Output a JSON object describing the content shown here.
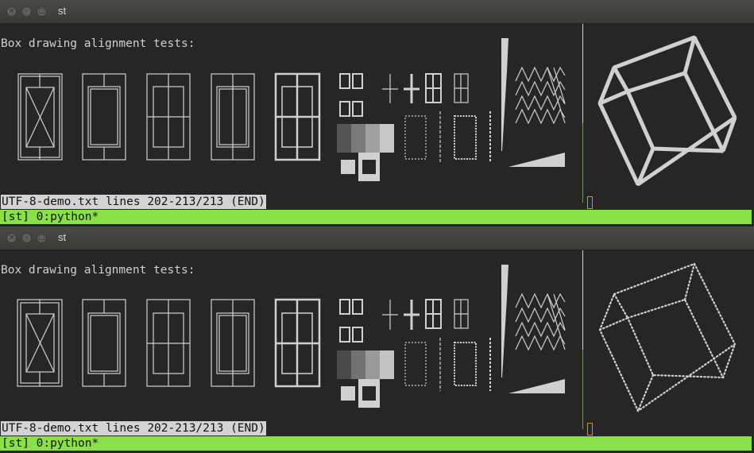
{
  "windows": [
    {
      "title": "st",
      "heading": "Box drawing alignment tests:",
      "status_line": "UTF-8-demo.txt lines 202-213/213 (END)",
      "tmux_status": "[st] 0:python*",
      "cube_style": "solid"
    },
    {
      "title": "st",
      "heading": "Box drawing alignment tests:",
      "status_line": "UTF-8-demo.txt lines 202-213/213 (END)",
      "tmux_status": "[st] 0:python*",
      "cube_style": "dotted"
    }
  ],
  "colors": {
    "tmux_bar": "#8ae049",
    "status_bg": "#d3d3d3",
    "cursor": "#e08a1e",
    "terminal_bg": "#262626"
  }
}
